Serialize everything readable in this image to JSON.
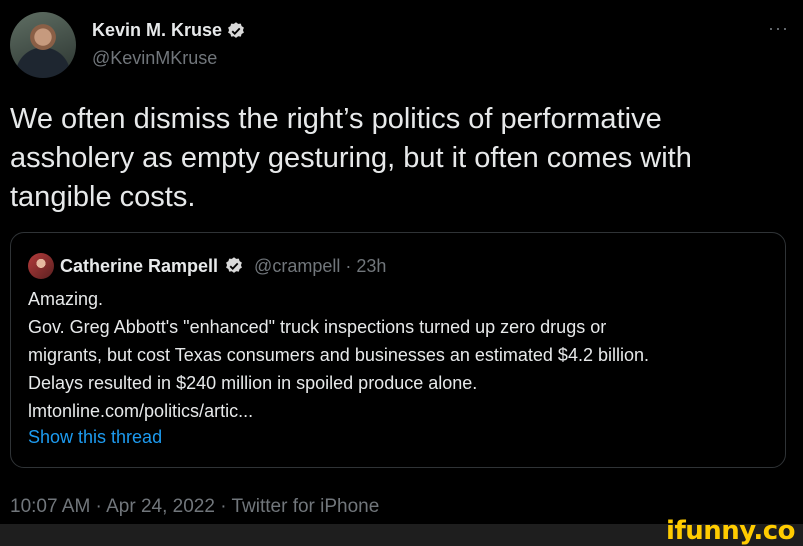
{
  "author": {
    "name": "Kevin M. Kruse",
    "handle": "@KevinMKruse",
    "verified": true
  },
  "more_label": "···",
  "tweet": {
    "line1": "We often dismiss the right’s politics of performative",
    "line2": "assholery as empty gesturing, but it often comes with",
    "line3": "tangible costs."
  },
  "quoted": {
    "name": "Catherine Rampell",
    "handle_time": "@crampell · 23h",
    "lines": [
      "Amazing.",
      "Gov. Greg Abbott's \"enhanced\" truck inspections turned up zero drugs or",
      "migrants, but cost Texas consumers and businesses an estimated $4.2 billion.",
      "Delays resulted in $240 million in spoiled produce alone.",
      "lmtonline.com/politics/artic..."
    ],
    "show_thread": "Show this thread"
  },
  "meta": "10:07 AM · Apr 24, 2022 · Twitter for iPhone",
  "watermark": "ifunny.co",
  "colors": {
    "background": "#000000",
    "text": "#e7e9ea",
    "muted": "#71767b",
    "link": "#1d9bf0",
    "verified": "#d9d9d9",
    "watermark": "#ffcc00"
  }
}
